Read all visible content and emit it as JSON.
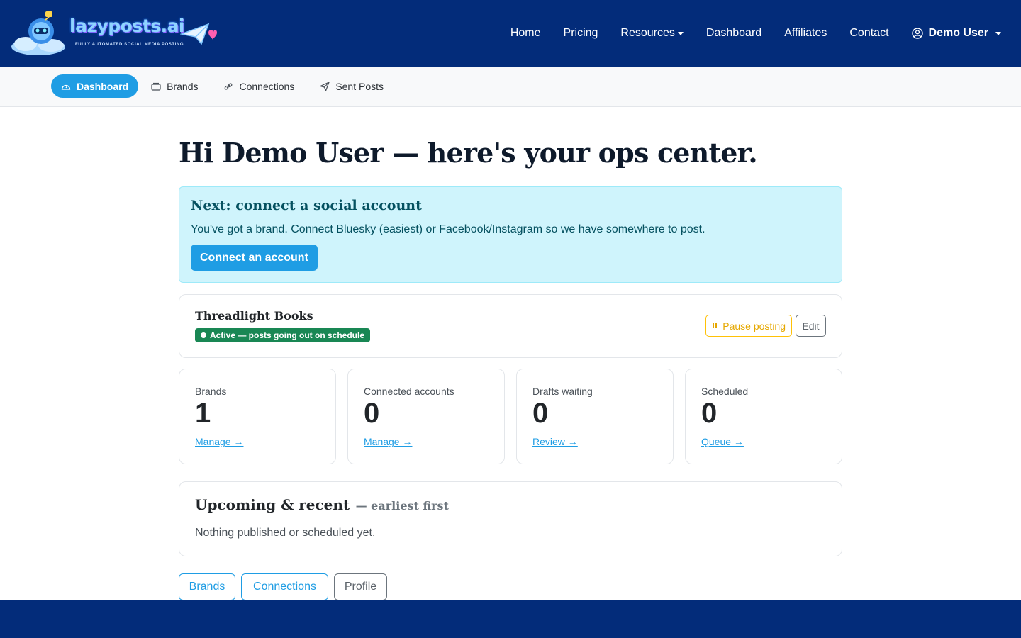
{
  "navbar": {
    "logo_text": "lazyposts.ai",
    "logo_tagline": "FULLY AUTOMATED SOCIAL MEDIA POSTING",
    "links": [
      {
        "label": "Home"
      },
      {
        "label": "Pricing"
      },
      {
        "label": "Resources"
      },
      {
        "label": "Dashboard"
      },
      {
        "label": "Affiliates"
      },
      {
        "label": "Contact"
      }
    ],
    "user_label": "Demo User"
  },
  "subnav": {
    "items": [
      {
        "label": "Dashboard",
        "icon": "gauge-icon"
      },
      {
        "label": "Brands",
        "icon": "folder-icon"
      },
      {
        "label": "Connections",
        "icon": "link-icon"
      },
      {
        "label": "Sent Posts",
        "icon": "send-icon"
      }
    ]
  },
  "hero": {
    "title": "Hi Demo User — here's your ops center."
  },
  "alert": {
    "title": "Next: connect a social account",
    "text": "You've got a brand. Connect Bluesky (easiest) or Facebook/Instagram so we have somewhere to post.",
    "button": "Connect an account"
  },
  "brand_card": {
    "name": "Threadlight Books",
    "status": "Active — posts going out on schedule",
    "pause_label": "Pause posting",
    "edit_label": "Edit"
  },
  "stats": [
    {
      "label": "Brands",
      "value": "1",
      "link": "Manage →"
    },
    {
      "label": "Connected accounts",
      "value": "0",
      "link": "Manage →"
    },
    {
      "label": "Drafts waiting",
      "value": "0",
      "link": "Review →"
    },
    {
      "label": "Scheduled",
      "value": "0",
      "link": "Queue →"
    }
  ],
  "upcoming": {
    "title": "Upcoming & recent",
    "subtitle": "— earliest first",
    "empty_text": "Nothing published or scheduled yet."
  },
  "bottom_buttons": [
    {
      "label": "Brands"
    },
    {
      "label": "Connections"
    },
    {
      "label": "Profile"
    }
  ],
  "colors": {
    "navbar_bg": "#032c7a",
    "accent": "#1f9de4",
    "alert_bg": "#cff4fc",
    "success": "#198754",
    "warning": "#ffc107"
  }
}
